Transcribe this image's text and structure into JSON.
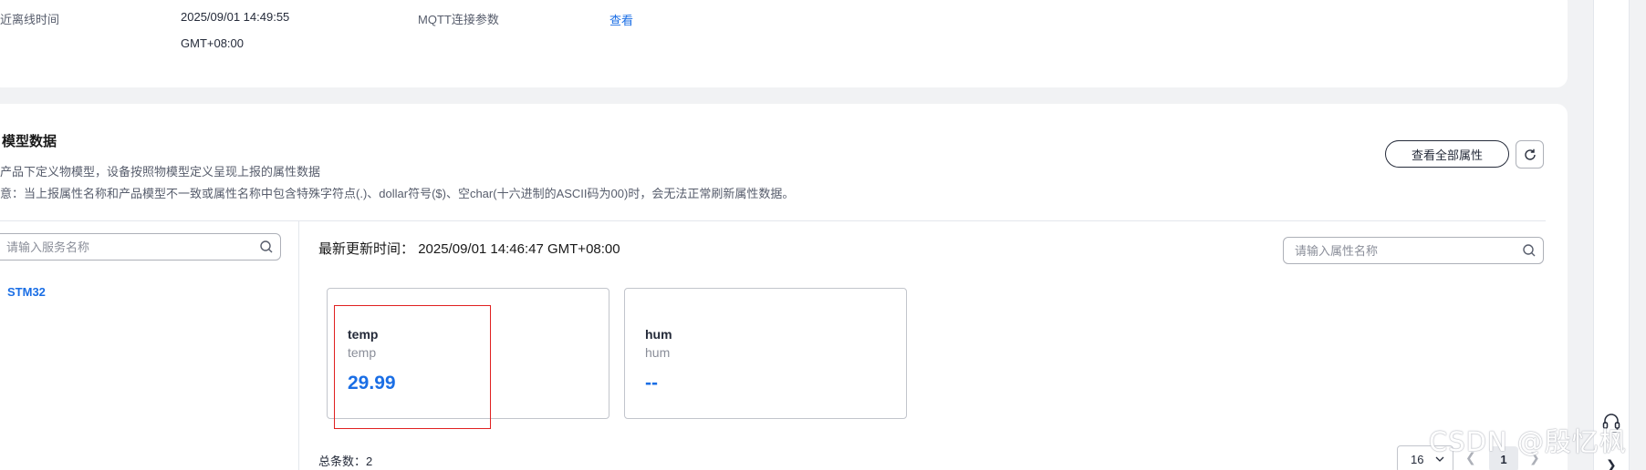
{
  "info": {
    "last_offline_label": "近离线时间",
    "last_offline_value_line1": "2025/09/01 14:49:55",
    "last_offline_value_line2": "GMT+08:00",
    "mqtt_label": "MQTT连接参数",
    "mqtt_link": "查看"
  },
  "model_section": {
    "title": "模型数据",
    "desc1": "产品下定义物模型，设备按照物模型定义呈现上报的属性数据",
    "desc2": "意：当上报属性名称和产品模型不一致或属性名称中包含特殊字符点(.)、dollar符号($)、空char(十六进制的ASCII码为00)时，会无法正常刷新属性数据。",
    "view_all_button": "查看全部属性"
  },
  "service_search": {
    "placeholder": "请输入服务名称"
  },
  "services": [
    "STM32"
  ],
  "update_time_label": "最新更新时间：",
  "update_time_value": "2025/09/01 14:46:47 GMT+08:00",
  "property_search": {
    "placeholder": "请输入属性名称"
  },
  "properties": [
    {
      "name": "temp",
      "id": "temp",
      "value": "29.99"
    },
    {
      "name": "hum",
      "id": "hum",
      "value": "--"
    }
  ],
  "pagination": {
    "total_label": "总条数：",
    "total": "2",
    "page_size": "16",
    "current_page": "1"
  },
  "watermark": "CSDN @殷忆枫",
  "colors": {
    "link": "#1a6ee5",
    "highlight": "#e02020"
  }
}
